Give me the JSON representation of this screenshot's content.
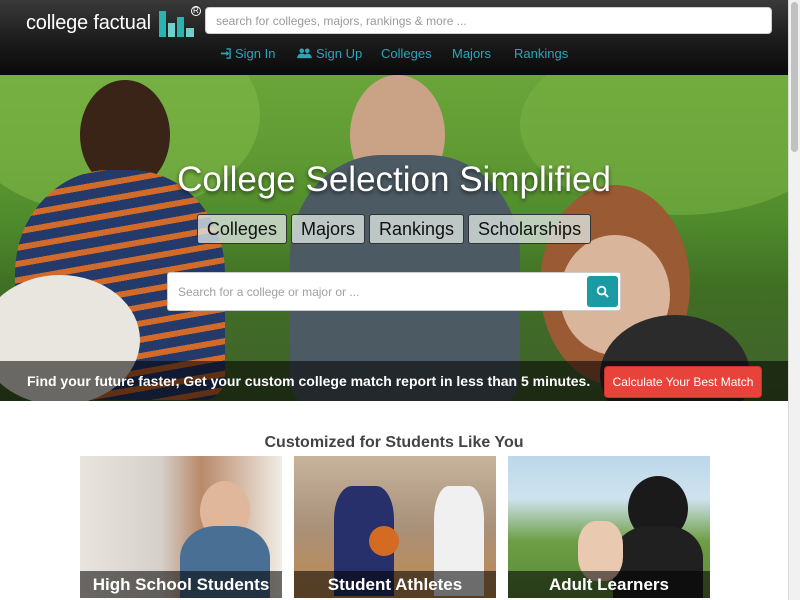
{
  "header": {
    "logo_text": "college factual",
    "search_placeholder": "search for colleges, majors, rankings & more ...",
    "nav": [
      {
        "label": "Sign In",
        "icon": "sign-in-icon"
      },
      {
        "label": "Sign Up",
        "icon": "users-icon"
      },
      {
        "label": "Colleges"
      },
      {
        "label": "Majors"
      },
      {
        "label": "Rankings"
      }
    ]
  },
  "hero": {
    "title": "College Selection Simplified",
    "tabs": [
      "Colleges",
      "Majors",
      "Rankings",
      "Scholarships"
    ],
    "search_placeholder": "Search for a college or major or ...",
    "banner_text": "Find your future faster, Get your custom college match report in less than 5 minutes.",
    "banner_button": "Calculate Your Best Match"
  },
  "section": {
    "title": "Customized for Students Like You",
    "cards": [
      "High School Students",
      "Student Athletes",
      "Adult Learners"
    ]
  },
  "colors": {
    "accent": "#2aa6b8",
    "search_button": "#1a9aa3",
    "cta": "#e8433a",
    "header_bg": "#1b1b1b"
  }
}
